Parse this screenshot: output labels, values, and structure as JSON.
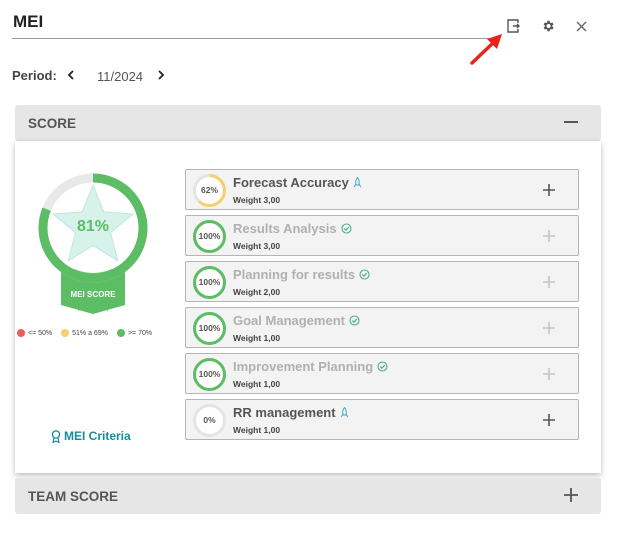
{
  "header": {
    "title": "MEI",
    "icons": [
      "export-icon",
      "gear-icon",
      "close-icon"
    ]
  },
  "period": {
    "label": "Period:",
    "value": "11/2024"
  },
  "score_section": {
    "label": "SCORE",
    "toggle_icon": "minus-icon",
    "badge": {
      "percent": "81%",
      "label": "MEI SCORE",
      "fill": 0.81,
      "color": "#5cbd65"
    },
    "legend": [
      {
        "label": "<= 50%",
        "color": "#e85c5c"
      },
      {
        "label": "51% a 69%",
        "color": "#f5d06b"
      },
      {
        "label": ">= 70%",
        "color": "#5cbd65"
      }
    ],
    "criteria_link": "MEI Criteria",
    "kpis": [
      {
        "name": "Forecast Accuracy",
        "weight": "Weight 3,00",
        "score": "62%",
        "fill": 0.62,
        "status": "rocket-icon",
        "done": false
      },
      {
        "name": "Results Analysis",
        "weight": "Weight 3,00",
        "score": "100%",
        "fill": 1.0,
        "status": "check-circle-icon",
        "done": true
      },
      {
        "name": "Planning for results",
        "weight": "Weight 2,00",
        "score": "100%",
        "fill": 1.0,
        "status": "check-circle-icon",
        "done": true
      },
      {
        "name": "Goal Management",
        "weight": "Weight 1,00",
        "score": "100%",
        "fill": 1.0,
        "status": "check-circle-icon",
        "done": true
      },
      {
        "name": "Improvement Planning",
        "weight": "Weight 1,00",
        "score": "100%",
        "fill": 1.0,
        "status": "check-circle-icon",
        "done": true
      },
      {
        "name": "RR management",
        "weight": "Weight 1,00",
        "score": "0%",
        "fill": 0,
        "status": "rocket-icon",
        "done": false
      }
    ]
  },
  "team_section": {
    "label": "TEAM SCORE",
    "toggle_icon": "plus-icon"
  },
  "colors": {
    "green": "#5cbd65",
    "yellow": "#f5d06b",
    "red": "#e85c5c",
    "link": "#1a8a9a",
    "annotation_arrow": "#e8231c"
  }
}
